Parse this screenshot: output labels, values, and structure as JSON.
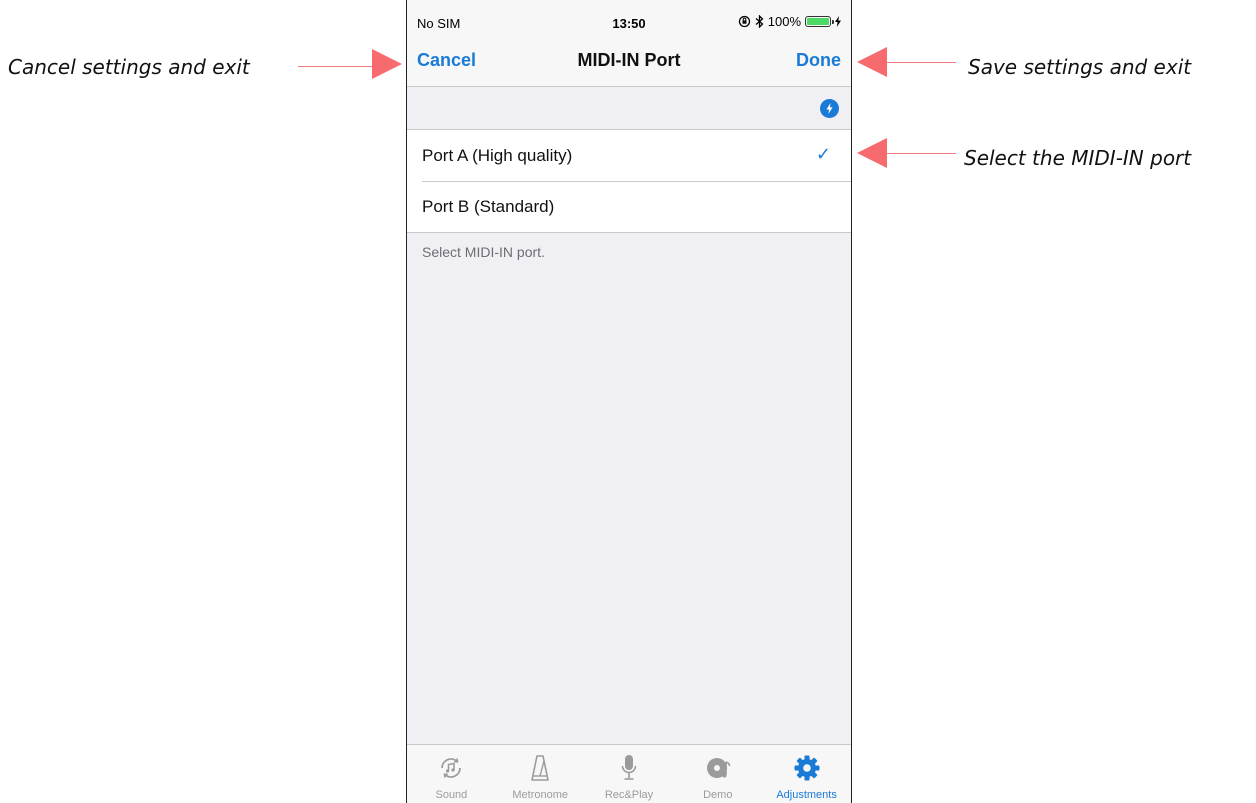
{
  "annotations": {
    "cancel": "Cancel settings and exit",
    "save": "Save settings and exit",
    "select": "Select the MIDI-IN port"
  },
  "status_bar": {
    "carrier": "No SIM",
    "time": "13:50",
    "battery": "100%"
  },
  "nav": {
    "cancel_label": "Cancel",
    "title": "MIDI-IN Port",
    "done_label": "Done"
  },
  "ports": [
    {
      "label": "Port A (High quality)",
      "selected": true
    },
    {
      "label": "Port B (Standard)",
      "selected": false
    }
  ],
  "footer_note": "Select MIDI-IN port.",
  "tabs": [
    {
      "label": "Sound",
      "icon": "sound-icon",
      "active": false
    },
    {
      "label": "Metronome",
      "icon": "metronome-icon",
      "active": false
    },
    {
      "label": "Rec&Play",
      "icon": "microphone-icon",
      "active": false
    },
    {
      "label": "Demo",
      "icon": "demo-disc-icon",
      "active": false
    },
    {
      "label": "Adjustments",
      "icon": "gear-icon",
      "active": true
    }
  ],
  "colors": {
    "accent": "#1a7bd6",
    "annotation_arrow": "#f76a6e",
    "battery": "#4cd964"
  }
}
